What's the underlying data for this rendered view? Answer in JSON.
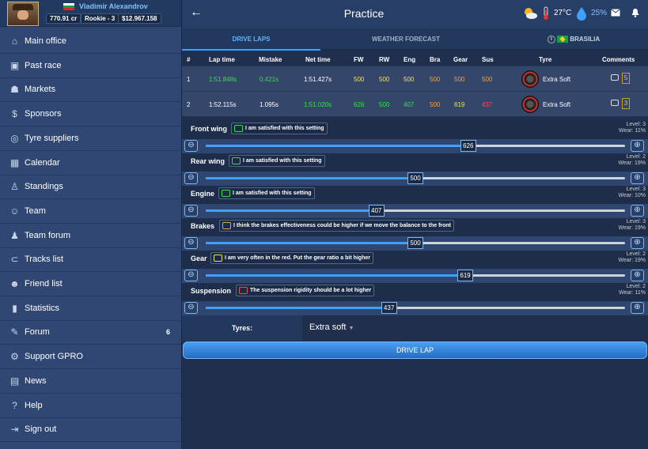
{
  "user": {
    "name": "Vladimir Alexandrov",
    "money": "770.91 cr",
    "rank": "Rookie - 3",
    "balance": "$12.967.158"
  },
  "menu": [
    {
      "label": "Main office",
      "icon": "home-icon",
      "glyph": "⌂"
    },
    {
      "label": "Past race",
      "icon": "past-race-icon",
      "glyph": "▣"
    },
    {
      "label": "Markets",
      "icon": "markets-icon",
      "glyph": "☗"
    },
    {
      "label": "Sponsors",
      "icon": "dollar-icon",
      "glyph": "$"
    },
    {
      "label": "Tyre suppliers",
      "icon": "tyre-icon",
      "glyph": "◎"
    },
    {
      "label": "Calendar",
      "icon": "calendar-icon",
      "glyph": "▦"
    },
    {
      "label": "Standings",
      "icon": "trophy-icon",
      "glyph": "♙"
    },
    {
      "label": "Team",
      "icon": "team-icon",
      "glyph": "☺"
    },
    {
      "label": "Team forum",
      "icon": "team-forum-icon",
      "glyph": "♟"
    },
    {
      "label": "Tracks list",
      "icon": "tracks-icon",
      "glyph": "⊂"
    },
    {
      "label": "Friend list",
      "icon": "friends-icon",
      "glyph": "☻"
    },
    {
      "label": "Statistics",
      "icon": "statistics-icon",
      "glyph": "▮"
    },
    {
      "label": "Forum",
      "icon": "forum-icon",
      "glyph": "✎",
      "badge": "6"
    },
    {
      "label": "Support GPRO",
      "icon": "support-icon",
      "glyph": "⚙"
    },
    {
      "label": "News",
      "icon": "news-icon",
      "glyph": "▤"
    },
    {
      "label": "Help",
      "icon": "help-icon",
      "glyph": "?"
    },
    {
      "label": "Sign out",
      "icon": "sign-out-icon",
      "glyph": "⇥"
    }
  ],
  "header": {
    "back": "←",
    "title": "Practice",
    "temperature": "27°C",
    "humidity": "25%"
  },
  "tabs": {
    "drive": "DRIVE LAPS",
    "weather": "WEATHER FORECAST",
    "track": "BRASILIA",
    "info": "i"
  },
  "table": {
    "headers": {
      "num": "#",
      "lap": "Lap time",
      "mistake": "Mistake",
      "net": "Net time",
      "fw": "FW",
      "rw": "RW",
      "eng": "Eng",
      "bra": "Bra",
      "gear": "Gear",
      "sus": "Sus",
      "tyre": "Tyre",
      "comments": "Comments"
    },
    "rows": [
      {
        "num": "1",
        "lap": "1:51.848s",
        "mistake": "0.421s",
        "net": "1:51.427s",
        "fw": "500",
        "rw": "500",
        "eng": "500",
        "bra": "500",
        "gear": "500",
        "sus": "500",
        "tyre": "Extra Soft",
        "count": "5"
      },
      {
        "num": "2",
        "lap": "1:52.115s",
        "mistake": "1.095s",
        "net": "1:51.020s",
        "fw": "626",
        "rw": "500",
        "eng": "407",
        "bra": "500",
        "gear": "619",
        "sus": "437",
        "tyre": "Extra Soft",
        "count": "3"
      }
    ]
  },
  "colors": {
    "green": "#3bdc4a",
    "yellow": "#f0e060",
    "orange": "#f0a040",
    "red": "#ff4a4a"
  },
  "params": [
    {
      "name": "Front wing",
      "msg": "I am satisfied with this setting",
      "msgColor": "#3bdc4a",
      "level": "Level: 3",
      "wear": "Wear: 11%",
      "value": "626",
      "pct": 0.626
    },
    {
      "name": "Rear wing",
      "msg": "I am satisfied with this setting",
      "msgColor": "#3bdc4a",
      "level": "Level: 2",
      "wear": "Wear: 19%",
      "value": "500",
      "pct": 0.5
    },
    {
      "name": "Engine",
      "msg": "I am satisfied with this setting",
      "msgColor": "#3bdc4a",
      "level": "Level: 3",
      "wear": "Wear: 10%",
      "value": "407",
      "pct": 0.407
    },
    {
      "name": "Brakes",
      "msg": "I think the brakes effectiveness could be higher if we move the balance to the front",
      "msgColor": "#f0a040",
      "level": "Level: 3",
      "wear": "Wear: 19%",
      "value": "500",
      "pct": 0.5
    },
    {
      "name": "Gear",
      "msg": "I am very often in the red. Put the gear ratio a bit higher",
      "msgColor": "#f0e060",
      "level": "Level: 2",
      "wear": "Wear: 19%",
      "value": "619",
      "pct": 0.619
    },
    {
      "name": "Suspension",
      "msg": "The suspension rigidity should be a lot higher",
      "msgColor": "#ff4a4a",
      "level": "Level: 2",
      "wear": "Wear: 11%",
      "value": "437",
      "pct": 0.437
    }
  ],
  "tyres": {
    "label": "Tyres:",
    "value": "Extra soft"
  },
  "drive_button": "DRIVE LAP"
}
